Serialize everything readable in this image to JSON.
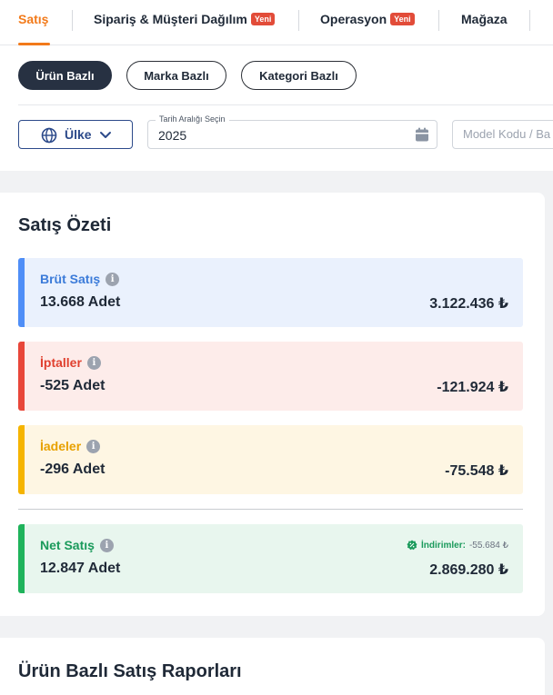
{
  "tabs": [
    {
      "label": "Satış",
      "active": true
    },
    {
      "label": "Sipariş & Müşteri Dağılım",
      "badge": "Yeni"
    },
    {
      "label": "Operasyon",
      "badge": "Yeni"
    },
    {
      "label": "Mağaza"
    }
  ],
  "filters": {
    "pills": [
      {
        "label": "Ürün Bazlı",
        "active": true
      },
      {
        "label": "Marka Bazlı"
      },
      {
        "label": "Kategori Bazlı"
      }
    ],
    "country_label": "Ülke",
    "date_legend": "Tarih Aralığı Seçin",
    "date_value": "2025",
    "model_placeholder": "Model Kodu / Ba"
  },
  "summary": {
    "title": "Satış Özeti",
    "items": [
      {
        "title": "Brüt Satış",
        "count": "13.668 Adet",
        "amount": "3.122.436 ₺",
        "color": "#4f8ef7",
        "bg": "#eaf1fd",
        "title_color": "#3b7bd9"
      },
      {
        "title": "İptaller",
        "count": "-525 Adet",
        "amount": "-121.924 ₺",
        "color": "#e8473a",
        "bg": "#fdecea",
        "title_color": "#e0402f"
      },
      {
        "title": "İadeler",
        "count": "-296 Adet",
        "amount": "-75.548 ₺",
        "color": "#f5b400",
        "bg": "#fef6e3",
        "title_color": "#e8a100"
      },
      {
        "title": "Net Satış",
        "count": "12.847 Adet",
        "amount": "2.869.280 ₺",
        "color": "#1fb35b",
        "bg": "#e8f6ee",
        "title_color": "#1a9a5b",
        "discount_label": "İndirimler:",
        "discount_value": "-55.684 ₺"
      }
    ]
  },
  "reports": {
    "title": "Ürün Bazlı Satış Raporları"
  },
  "icons": [
    "globe-icon",
    "chevron-down-icon",
    "calendar-icon",
    "info-icon",
    "discount-icon"
  ]
}
